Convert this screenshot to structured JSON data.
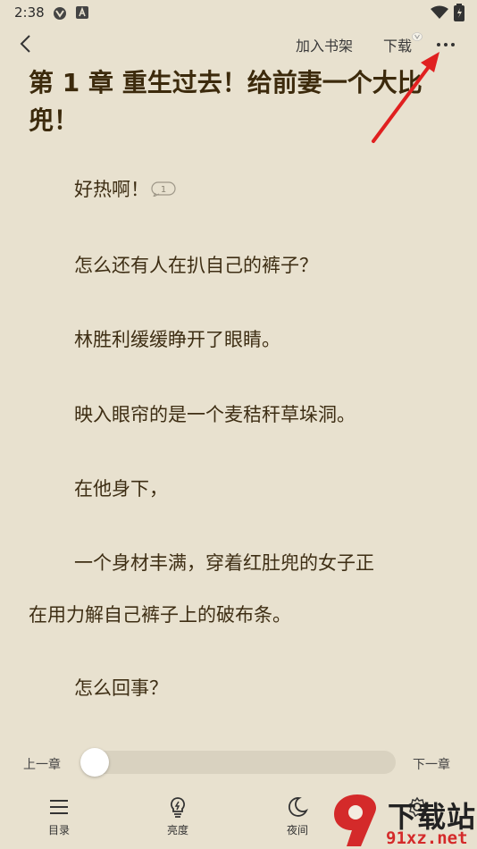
{
  "status": {
    "time": "2:38"
  },
  "header": {
    "add_shelf": "加入书架",
    "download": "下载"
  },
  "chapter": {
    "title": "第 1 章 重生过去！给前妻一个大比兜！"
  },
  "paragraphs": {
    "p1": "好热啊！",
    "p1_badge": "1",
    "p2": "怎么还有人在扒自己的裤子？",
    "p3": "林胜利缓缓睁开了眼睛。",
    "p4": "映入眼帘的是一个麦秸秆草垛洞。",
    "p5": "在他身下，",
    "p6a": "一个身材丰满，穿着红肚兜的女子正",
    "p6b": "在用力解自己裤子上的破布条。",
    "p7": "怎么回事？"
  },
  "progress": {
    "prev": "上一章",
    "next": "下一章",
    "value": 0
  },
  "toolbar": {
    "toc": "目录",
    "brightness": "亮度",
    "night": "夜间"
  },
  "watermark": {
    "brand": "下载站",
    "site": "91xz.net"
  },
  "colors": {
    "background": "#e8e1cf",
    "title": "#3c2a0c",
    "text": "#3e2e14",
    "arrow": "#e02020"
  }
}
